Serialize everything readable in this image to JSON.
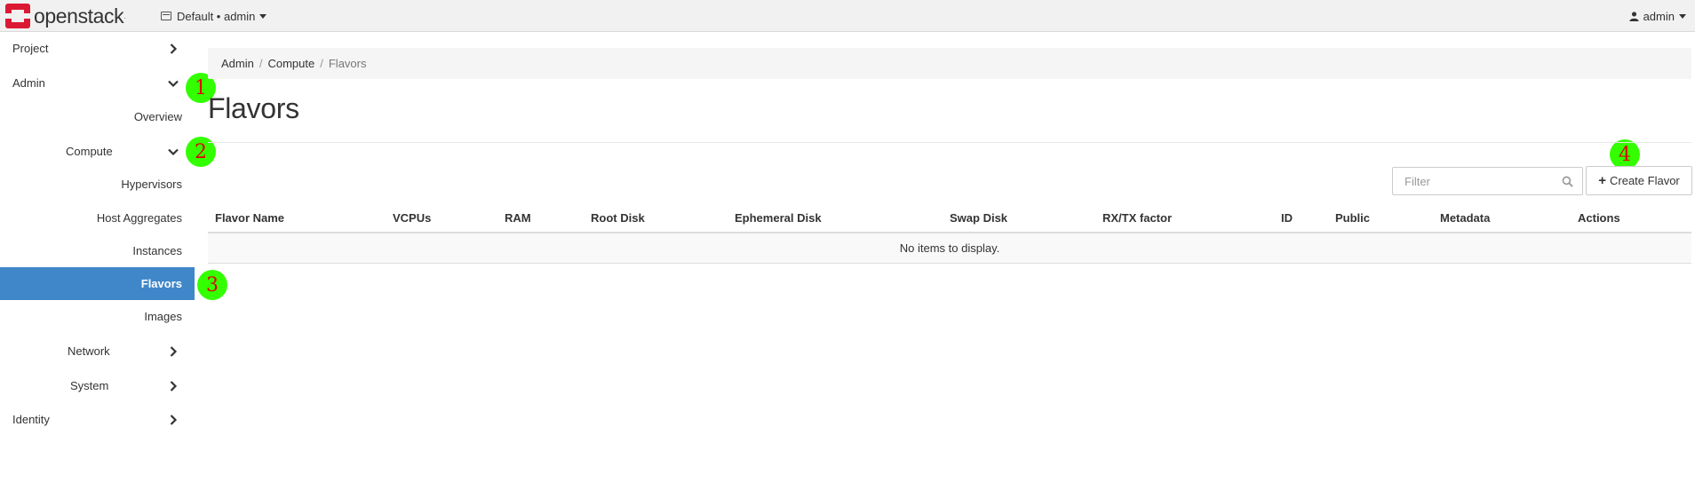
{
  "brand": {
    "name": "openstack",
    "tm": "."
  },
  "header": {
    "project_picker": "Default • admin",
    "user": "admin"
  },
  "sidebar": {
    "project": "Project",
    "admin": "Admin",
    "overview": "Overview",
    "compute": "Compute",
    "hypervisors": "Hypervisors",
    "host_aggregates": "Host Aggregates",
    "instances": "Instances",
    "flavors": "Flavors",
    "images": "Images",
    "network": "Network",
    "system": "System",
    "identity": "Identity"
  },
  "markers": [
    "1",
    "2",
    "3",
    "4"
  ],
  "breadcrumb": {
    "admin": "Admin",
    "compute": "Compute",
    "flavors": "Flavors",
    "separator": "/"
  },
  "page_title": "Flavors",
  "filter": {
    "placeholder": "Filter",
    "value": ""
  },
  "create_button": {
    "icon": "+",
    "label": "Create Flavor"
  },
  "table": {
    "columns": [
      "Flavor Name",
      "VCPUs",
      "RAM",
      "Root Disk",
      "Ephemeral Disk",
      "Swap Disk",
      "RX/TX factor",
      "ID",
      "Public",
      "Metadata",
      "Actions"
    ],
    "empty_message": "No items to display."
  },
  "colors": {
    "active_nav": "#3f87c9",
    "marker_fill": "#33ff00",
    "marker_text": "#e00000",
    "brand_red": "#da1a32"
  }
}
